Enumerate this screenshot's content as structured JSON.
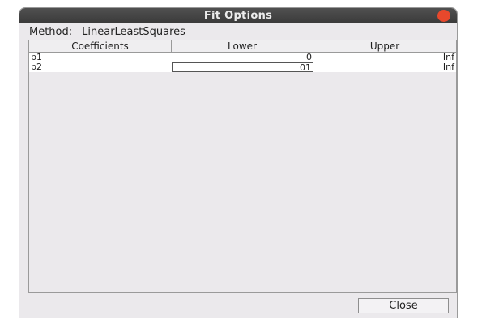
{
  "window": {
    "title": "Fit Options",
    "close_color": "#e8482c"
  },
  "method": {
    "label": "Method:",
    "value": "LinearLeastSquares"
  },
  "table": {
    "headers": [
      "Coefficients",
      "Lower",
      "Upper"
    ],
    "rows": [
      {
        "coefficient": "p1",
        "lower": "0",
        "upper": "Inf"
      },
      {
        "coefficient": "p2",
        "lower": "01",
        "upper": "Inf"
      }
    ]
  },
  "buttons": {
    "close_label": "Close"
  }
}
